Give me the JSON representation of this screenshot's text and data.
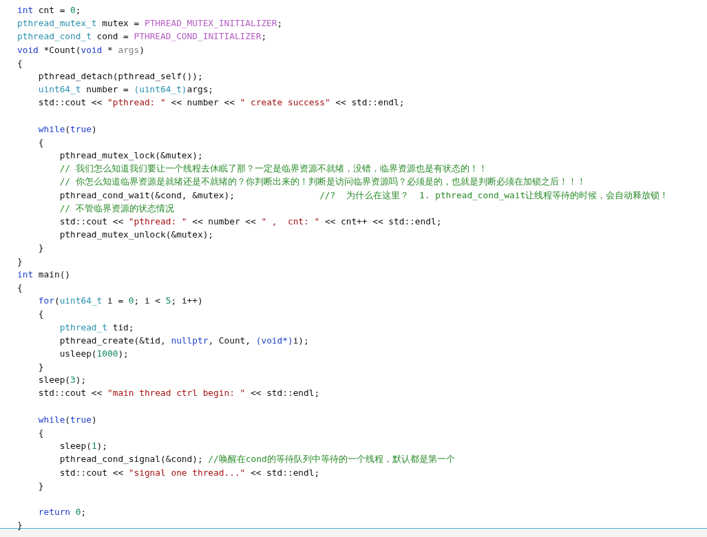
{
  "editor": {
    "lines": [
      {
        "tokens": [
          {
            "kind": "kw",
            "text": "int"
          },
          {
            "kind": "plain",
            "text": " cnt = "
          },
          {
            "kind": "num",
            "text": "0"
          },
          {
            "kind": "plain",
            "text": ";"
          }
        ]
      },
      {
        "tokens": [
          {
            "kind": "type",
            "text": "pthread_mutex_t"
          },
          {
            "kind": "plain",
            "text": " mutex = "
          },
          {
            "kind": "macro",
            "text": "PTHREAD_MUTEX_INITIALIZER"
          },
          {
            "kind": "plain",
            "text": ";"
          }
        ]
      },
      {
        "tokens": [
          {
            "kind": "type",
            "text": "pthread_cond_t"
          },
          {
            "kind": "plain",
            "text": " cond = "
          },
          {
            "kind": "macro",
            "text": "PTHREAD_COND_INITIALIZER"
          },
          {
            "kind": "plain",
            "text": ";"
          }
        ]
      },
      {
        "tokens": [
          {
            "kind": "kw",
            "text": "void"
          },
          {
            "kind": "plain",
            "text": " *Count("
          },
          {
            "kind": "kw",
            "text": "void"
          },
          {
            "kind": "plain",
            "text": " * "
          },
          {
            "kind": "param",
            "text": "args"
          },
          {
            "kind": "plain",
            "text": ")"
          }
        ]
      },
      {
        "tokens": [
          {
            "kind": "plain",
            "text": "{"
          }
        ]
      },
      {
        "tokens": [
          {
            "kind": "plain",
            "text": "    pthread_detach(pthread_self());"
          }
        ]
      },
      {
        "tokens": [
          {
            "kind": "type",
            "text": "    uint64_t"
          },
          {
            "kind": "plain",
            "text": " number = "
          },
          {
            "kind": "type",
            "text": "(uint64_t)"
          },
          {
            "kind": "plain",
            "text": "args;"
          }
        ]
      },
      {
        "tokens": [
          {
            "kind": "plain",
            "text": "    std::cout << "
          },
          {
            "kind": "str",
            "text": "\"pthread: \""
          },
          {
            "kind": "plain",
            "text": " << number << "
          },
          {
            "kind": "str",
            "text": "\" create success\""
          },
          {
            "kind": "plain",
            "text": " << std::endl;"
          }
        ]
      },
      {
        "gap_before": true,
        "tokens": [
          {
            "kind": "kw",
            "text": "    while"
          },
          {
            "kind": "plain",
            "text": "("
          },
          {
            "kind": "kw",
            "text": "true"
          },
          {
            "kind": "plain",
            "text": ")"
          }
        ]
      },
      {
        "tokens": [
          {
            "kind": "plain",
            "text": "    {"
          }
        ]
      },
      {
        "tokens": [
          {
            "kind": "plain",
            "text": "        pthread_mutex_lock(&mutex);"
          }
        ]
      },
      {
        "tokens": [
          {
            "kind": "comment",
            "text": "        // 我们怎么知道我们要让一个线程去休眠了那？一定是临界资源不就绪，没错，临界资源也是有状态的！！"
          }
        ]
      },
      {
        "tokens": [
          {
            "kind": "comment",
            "text": "        // 你怎么知道临界资源是就绪还是不就绪的？你判断出来的！判断是访问临界资源吗？必须是的，也就是判断必须在加锁之后！！！"
          }
        ]
      },
      {
        "tokens": [
          {
            "kind": "plain",
            "text": "        pthread_cond_wait(&cond, &mutex);                "
          },
          {
            "kind": "comment",
            "text": "//?  为什么在这里？  1. pthread_cond_wait让线程等待的时候，会自动释放锁！"
          }
        ]
      },
      {
        "tokens": [
          {
            "kind": "comment",
            "text": "        // 不管临界资源的状态情况"
          }
        ]
      },
      {
        "tokens": [
          {
            "kind": "plain",
            "text": "        std::cout << "
          },
          {
            "kind": "str",
            "text": "\"pthread: \""
          },
          {
            "kind": "plain",
            "text": " << number << "
          },
          {
            "kind": "str",
            "text": "\" ,  cnt: \""
          },
          {
            "kind": "plain",
            "text": " << cnt++ << std::endl;"
          }
        ]
      },
      {
        "tokens": [
          {
            "kind": "plain",
            "text": "        pthread_mutex_unlock(&mutex);"
          }
        ]
      },
      {
        "tokens": [
          {
            "kind": "plain",
            "text": "    }"
          }
        ]
      },
      {
        "tokens": [
          {
            "kind": "plain",
            "text": "}"
          }
        ]
      },
      {
        "tokens": [
          {
            "kind": "kw",
            "text": "int"
          },
          {
            "kind": "plain",
            "text": " main()"
          }
        ]
      },
      {
        "tokens": [
          {
            "kind": "plain",
            "text": "{"
          }
        ]
      },
      {
        "tokens": [
          {
            "kind": "kw",
            "text": "    for"
          },
          {
            "kind": "plain",
            "text": "("
          },
          {
            "kind": "type",
            "text": "uint64_t"
          },
          {
            "kind": "plain",
            "text": " i = "
          },
          {
            "kind": "num",
            "text": "0"
          },
          {
            "kind": "plain",
            "text": "; i < "
          },
          {
            "kind": "num",
            "text": "5"
          },
          {
            "kind": "plain",
            "text": "; i++)"
          }
        ]
      },
      {
        "tokens": [
          {
            "kind": "plain",
            "text": "    {"
          }
        ]
      },
      {
        "tokens": [
          {
            "kind": "type",
            "text": "        pthread_t"
          },
          {
            "kind": "plain",
            "text": " tid;"
          }
        ]
      },
      {
        "tokens": [
          {
            "kind": "plain",
            "text": "        pthread_create(&tid, "
          },
          {
            "kind": "kw",
            "text": "nullptr"
          },
          {
            "kind": "plain",
            "text": ", Count, "
          },
          {
            "kind": "kw",
            "text": "(void*)"
          },
          {
            "kind": "plain",
            "text": "i);"
          }
        ]
      },
      {
        "tokens": [
          {
            "kind": "plain",
            "text": "        usleep("
          },
          {
            "kind": "num",
            "text": "1000"
          },
          {
            "kind": "plain",
            "text": ");"
          }
        ]
      },
      {
        "tokens": [
          {
            "kind": "plain",
            "text": "    }"
          }
        ]
      },
      {
        "tokens": [
          {
            "kind": "plain",
            "text": "    sleep("
          },
          {
            "kind": "num",
            "text": "3"
          },
          {
            "kind": "plain",
            "text": ");"
          }
        ]
      },
      {
        "tokens": [
          {
            "kind": "plain",
            "text": "    std::cout << "
          },
          {
            "kind": "str",
            "text": "\"main thread ctrl begin: \""
          },
          {
            "kind": "plain",
            "text": " << std::endl;"
          }
        ]
      },
      {
        "gap_before": true,
        "tokens": [
          {
            "kind": "kw",
            "text": "    while"
          },
          {
            "kind": "plain",
            "text": "("
          },
          {
            "kind": "kw",
            "text": "true"
          },
          {
            "kind": "plain",
            "text": ")"
          }
        ]
      },
      {
        "tokens": [
          {
            "kind": "plain",
            "text": "    {"
          }
        ]
      },
      {
        "tokens": [
          {
            "kind": "plain",
            "text": "        sleep("
          },
          {
            "kind": "num",
            "text": "1"
          },
          {
            "kind": "plain",
            "text": ");"
          }
        ]
      },
      {
        "tokens": [
          {
            "kind": "plain",
            "text": "        pthread_cond_signal(&cond); "
          },
          {
            "kind": "comment",
            "text": "//唤醒在cond的等待队列中等待的一个线程，默认都是第一个"
          }
        ]
      },
      {
        "tokens": [
          {
            "kind": "plain",
            "text": "        std::cout << "
          },
          {
            "kind": "str",
            "text": "\"signal one thread...\""
          },
          {
            "kind": "plain",
            "text": " << std::endl;"
          }
        ]
      },
      {
        "tokens": [
          {
            "kind": "plain",
            "text": "    }"
          }
        ]
      },
      {
        "gap_before": true,
        "tokens": [
          {
            "kind": "kw",
            "text": "    return "
          },
          {
            "kind": "num",
            "text": "0"
          },
          {
            "kind": "plain",
            "text": ";"
          }
        ]
      },
      {
        "tokens": [
          {
            "kind": "plain",
            "text": "}"
          }
        ]
      }
    ]
  }
}
